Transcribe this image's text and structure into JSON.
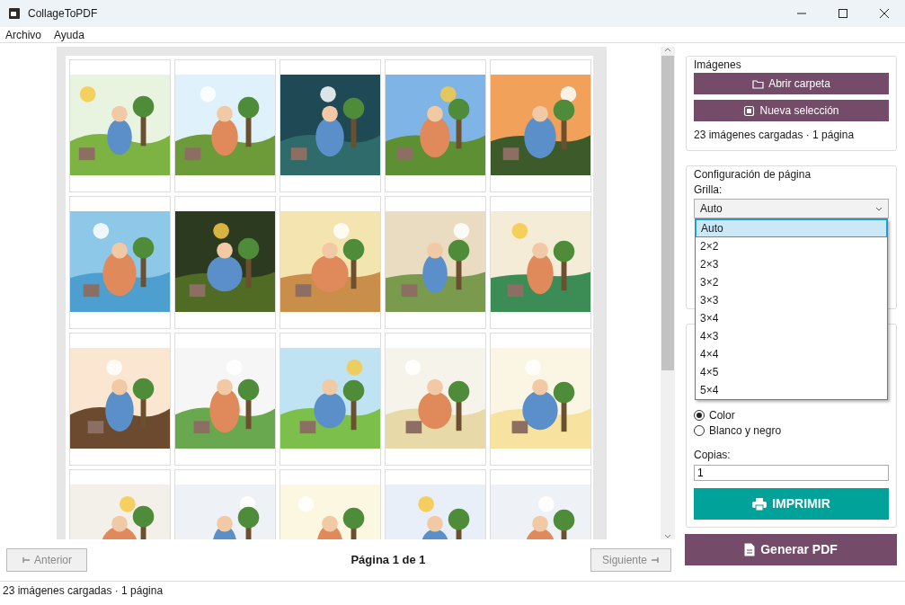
{
  "window": {
    "title": "CollageToPDF"
  },
  "menu": [
    "Archivo",
    "Ayuda"
  ],
  "pager": {
    "previous": {
      "label": "Anterior",
      "disabled": true
    },
    "page_label": "Página 1 de 1",
    "next": {
      "label": "Siguiente",
      "disabled": true
    }
  },
  "images_group": {
    "title": "Imágenes",
    "buttons": [
      "Abrir carpeta",
      "Nueva selección"
    ],
    "summary": "23 imágenes cargadas · 1 página"
  },
  "page_group": {
    "title": "Configuración de página",
    "grid_label": "Grilla:",
    "grid_value": "Auto",
    "dropdown": {
      "expanded": true,
      "options": [
        {
          "label": "Auto",
          "selected": true
        },
        {
          "label": "2×2",
          "selected": false
        },
        {
          "label": "2×3",
          "selected": false
        },
        {
          "label": "3×2",
          "selected": false
        },
        {
          "label": "3×3",
          "selected": false
        },
        {
          "label": "3×4",
          "selected": false
        },
        {
          "label": "4×3",
          "selected": false
        },
        {
          "label": "4×4",
          "selected": false
        },
        {
          "label": "4×5",
          "selected": false
        },
        {
          "label": "5×4",
          "selected": false
        }
      ]
    }
  },
  "print_group": {
    "color_options": [
      {
        "label": "Color",
        "selected": true
      },
      {
        "label": "Blanco y negro",
        "selected": false
      }
    ],
    "copies_label": "Copias:",
    "copies_value": "1",
    "print_button": "IMPRIMIR"
  },
  "generate_button": "Generar PDF",
  "status_bar": "23 imágenes cargadas · 1 página"
}
